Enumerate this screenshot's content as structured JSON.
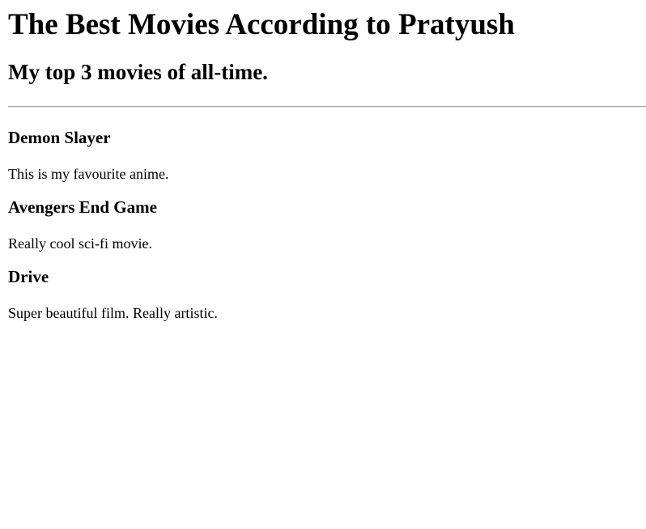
{
  "page": {
    "title": "The Best Movies According to Pratyush",
    "subtitle": "My top 3 movies of all-time."
  },
  "movies": [
    {
      "name": "Demon Slayer",
      "description": "This is my favourite anime."
    },
    {
      "name": "Avengers End Game",
      "description": "Really cool sci-fi movie."
    },
    {
      "name": "Drive",
      "description": "Super beautiful film. Really artistic."
    }
  ]
}
